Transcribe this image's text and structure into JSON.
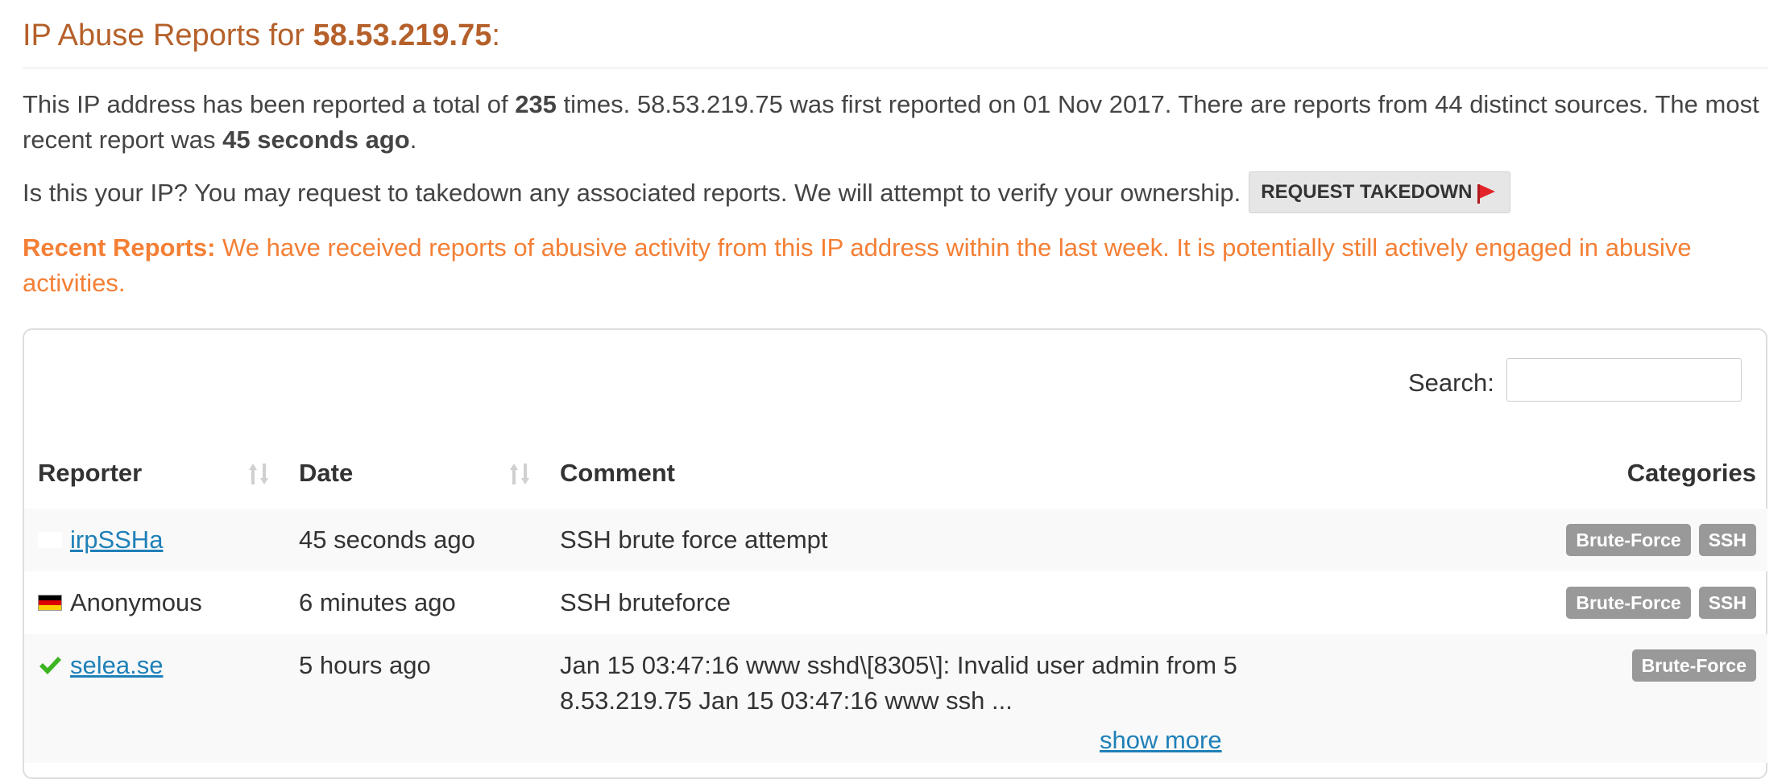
{
  "header": {
    "title_prefix": "IP Abuse Reports for ",
    "ip": "58.53.219.75",
    "title_suffix": ":"
  },
  "summary": {
    "text_a": "This IP address has been reported a total of ",
    "total_reports": "235",
    "text_b": " times. 58.53.219.75 was first reported on 01 Nov 2017. There are reports from 44 distinct sources. The most recent report was ",
    "most_recent": "45 seconds ago",
    "text_c": "."
  },
  "ownership": {
    "text": "Is this your IP? You may request to takedown any associated reports. We will attempt to verify your ownership.",
    "takedown_label": "REQUEST TAKEDOWN",
    "takedown_icon": "red-flag-icon"
  },
  "recent": {
    "label": "Recent Reports:",
    "text": " We have received reports of abusive activity from this IP address within the last week. It is potentially still actively engaged in abusive activities.",
    "color": "#f47f35"
  },
  "table": {
    "search_label": "Search:",
    "search_value": "",
    "columns": [
      "Reporter",
      "Date",
      "Comment",
      "Categories"
    ],
    "rows": [
      {
        "reporter": "irpSSHa",
        "reporter_icon": "blank-flag-icon",
        "reporter_is_link": true,
        "date": "45 seconds ago",
        "comment": "SSH brute force attempt",
        "categories": [
          "Brute-Force",
          "SSH"
        ]
      },
      {
        "reporter": "Anonymous",
        "reporter_icon": "germany-flag-icon",
        "reporter_is_link": false,
        "date": "6 minutes ago",
        "comment": "SSH bruteforce",
        "categories": [
          "Brute-Force",
          "SSH"
        ]
      },
      {
        "reporter": "selea.se",
        "reporter_icon": "verified-check-icon",
        "reporter_is_link": true,
        "date": "5 hours ago",
        "comment": "Jan 15 03:47:16 www sshd\\[8305\\]: Invalid user admin from 58.53.219.75 Jan 15 03:47:16 www ssh ...",
        "show_more": "show more",
        "categories": [
          "Brute-Force"
        ]
      }
    ]
  },
  "colors": {
    "title": "#b5602a",
    "link": "#1f80b8",
    "badge": "#999999"
  }
}
